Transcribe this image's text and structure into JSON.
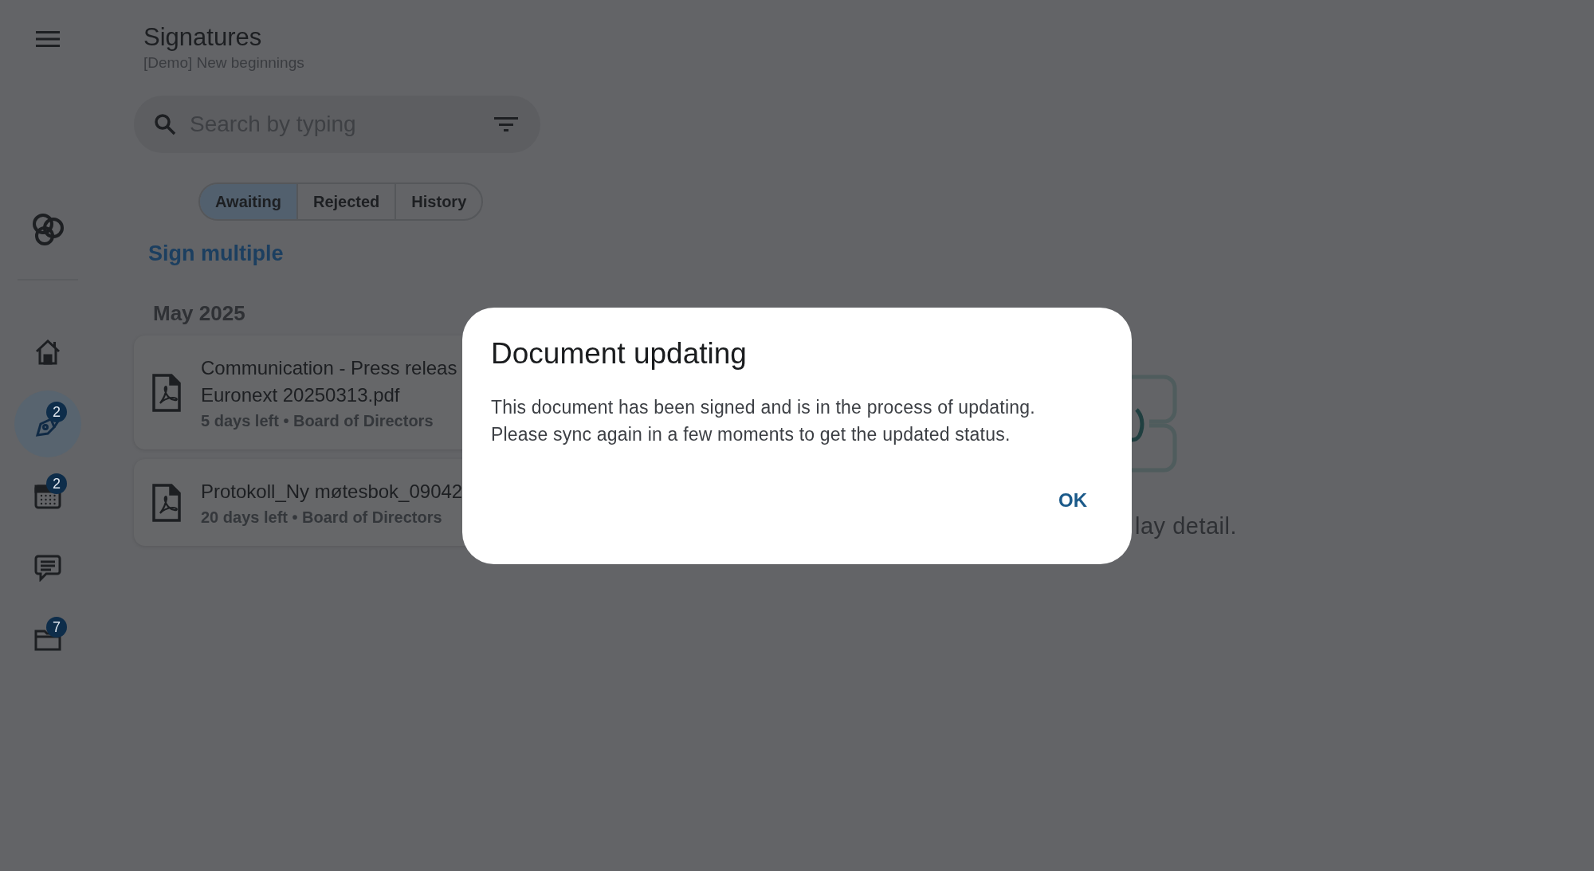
{
  "header": {
    "title": "Signatures",
    "subtitle": "[Demo] New beginnings"
  },
  "nav": [
    {
      "kind": "home",
      "selected": false
    },
    {
      "kind": "signatures",
      "badge": "2",
      "selected": true
    },
    {
      "kind": "calendar",
      "badge": "2",
      "selected": false
    },
    {
      "kind": "chat",
      "selected": false
    },
    {
      "kind": "folder",
      "badge": "7",
      "selected": false
    }
  ],
  "search": {
    "placeholder": "Search by typing"
  },
  "tabs": [
    {
      "label": "Awaiting",
      "selected": true
    },
    {
      "label": "Rejected",
      "selected": false
    },
    {
      "label": "History",
      "selected": false
    }
  ],
  "sign_multiple": "Sign multiple",
  "group": "May 2025",
  "documents": [
    {
      "title_lines": [
        "Communication - Press releas",
        "Euronext 20250313.pdf"
      ],
      "meta": "5 days left • Board of Directors"
    },
    {
      "title_lines": [
        "Protokoll_Ny møtesbok_09042"
      ],
      "meta": "20 days left • Board of Directors"
    }
  ],
  "detail_hint": "lay detail.",
  "dialog": {
    "title": "Document updating",
    "body_lines": [
      "This document has been signed and is in the process of updating.",
      "Please sync again in a few moments to get the updated status."
    ],
    "button": "OK"
  }
}
